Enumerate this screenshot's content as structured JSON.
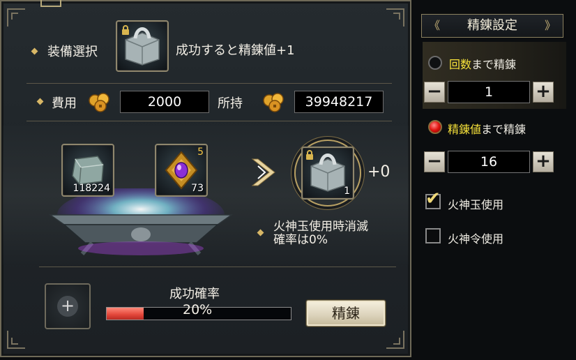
{
  "equip": {
    "select_label": "装備選択",
    "success_text": "成功すると精錬値+1"
  },
  "cost": {
    "label": "費用",
    "value": "2000",
    "owned_label": "所持",
    "owned_value": "39948217"
  },
  "materials": [
    {
      "name": "stone",
      "count": "118224"
    },
    {
      "name": "gem",
      "count": "73",
      "badge": "5"
    }
  ],
  "result": {
    "count": "1",
    "bonus": "+0"
  },
  "note": {
    "line1": "火神玉使用時消滅",
    "line2": "確率は0%"
  },
  "success": {
    "label": "成功確率",
    "rate_text": "20%",
    "rate": 0.2
  },
  "refine_button": "精錬",
  "settings": {
    "title": "精錬設定",
    "option_count": {
      "highlight": "回数",
      "rest": "まで精錬",
      "value": "1",
      "selected": false
    },
    "option_level": {
      "highlight": "精錬値",
      "rest": "まで精錬",
      "value": "16",
      "selected": true
    },
    "minus": "−",
    "plus": "+",
    "check_fire_jade": {
      "label": "火神玉使用",
      "checked": true
    },
    "check_fire_order": {
      "label": "火神令使用",
      "checked": false
    }
  },
  "colors": {
    "accent_gold": "#d8b766",
    "highlight_yellow": "#f7e23a",
    "progress_red": "#e2463a"
  },
  "icons": [
    "lock-icon",
    "coin-icon",
    "chevron-right-icon",
    "plus-icon",
    "checkmark-icon"
  ]
}
